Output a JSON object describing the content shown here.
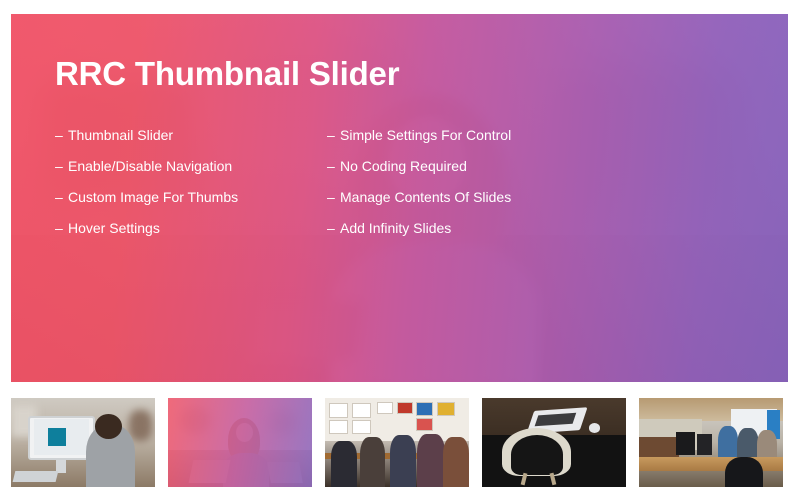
{
  "hero": {
    "title": "RRC Thumbnail Slider",
    "bullet_marker": "–",
    "features_left": [
      "Thumbnail Slider",
      "Enable/Disable Navigation",
      "Custom Image For Thumbs",
      "Hover Settings"
    ],
    "features_right": [
      "Simple Settings For Control",
      "No Coding Required",
      "Manage Contents Of Slides",
      "Add Infinity Slides"
    ],
    "gradient_start": "#f2485f",
    "gradient_mid": "#c24c99",
    "gradient_end": "#8059bb",
    "background_image_description": "office-woman-at-desk-photo"
  },
  "thumbnails": [
    {
      "name": "office-desk-imac-thumbnail",
      "active": false
    },
    {
      "name": "woman-laptop-cafe-thumbnail",
      "active": true
    },
    {
      "name": "group-meeting-gallery-thumbnail",
      "active": false
    },
    {
      "name": "dark-desk-laptop-chair-thumbnail",
      "active": false
    },
    {
      "name": "open-office-table-thumbnail",
      "active": false
    }
  ]
}
